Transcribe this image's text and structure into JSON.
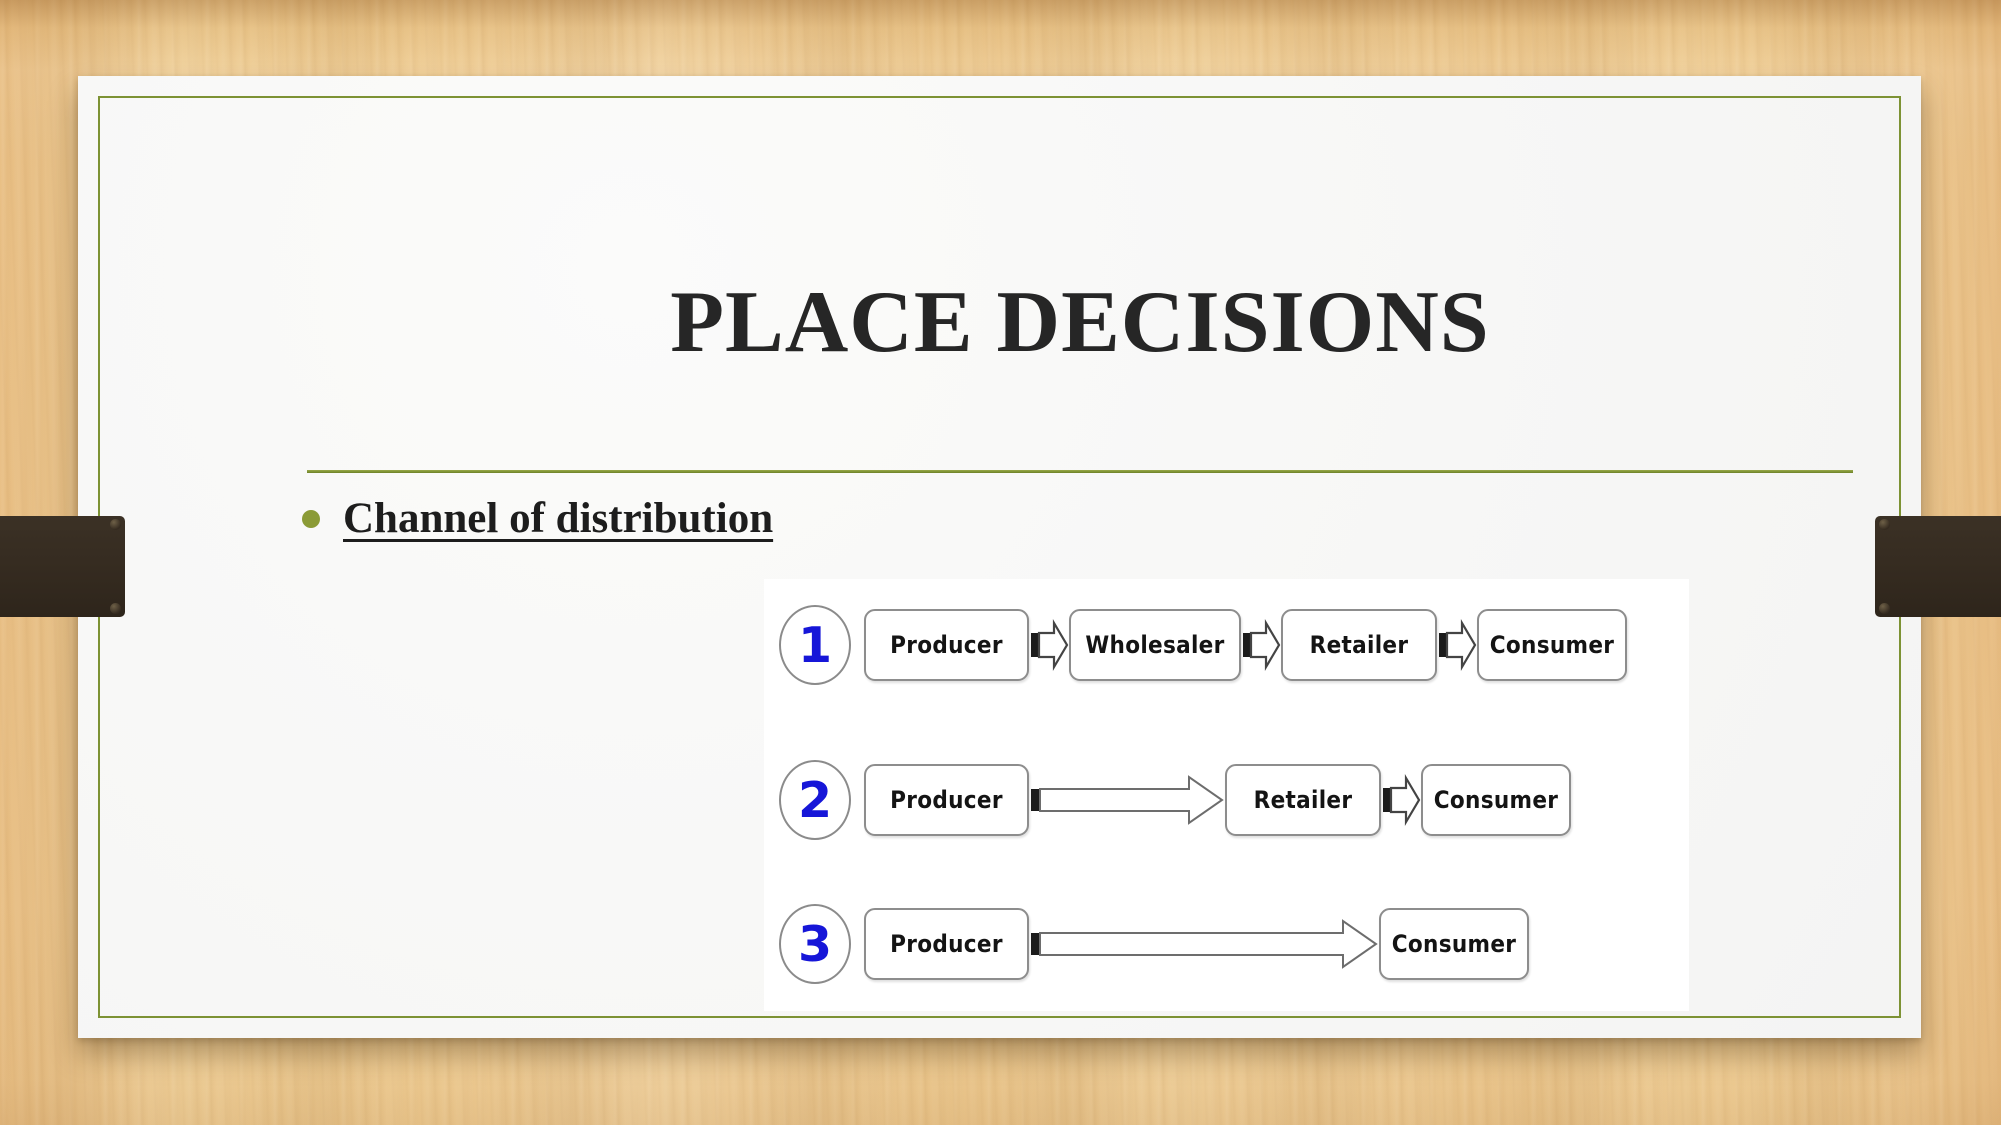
{
  "slide": {
    "title": "PLACE DECISIONS",
    "bullets": [
      {
        "text": "Channel of distribution",
        "bullet_glyph": "•"
      }
    ]
  },
  "theme": {
    "background": "#efcb90",
    "card_background": "#f7f7f6",
    "accent_green": "#7d9234",
    "bullet_color": "#8b9b36",
    "title_color": "#262626",
    "clip_color": "#362c21",
    "diagram_number_color": "#1616d8"
  },
  "diagram": {
    "name": "channels-of-distribution",
    "rows": [
      {
        "number": "1",
        "nodes": [
          "Producer",
          "Wholesaler",
          "Retailer",
          "Consumer"
        ],
        "connectors": [
          "short-arrow",
          "short-arrow",
          "short-arrow"
        ]
      },
      {
        "number": "2",
        "nodes": [
          "Producer",
          "Retailer",
          "Consumer"
        ],
        "connectors": [
          "long-arrow",
          "short-arrow"
        ]
      },
      {
        "number": "3",
        "nodes": [
          "Producer",
          "Consumer"
        ],
        "connectors": [
          "long-arrow"
        ]
      }
    ]
  }
}
